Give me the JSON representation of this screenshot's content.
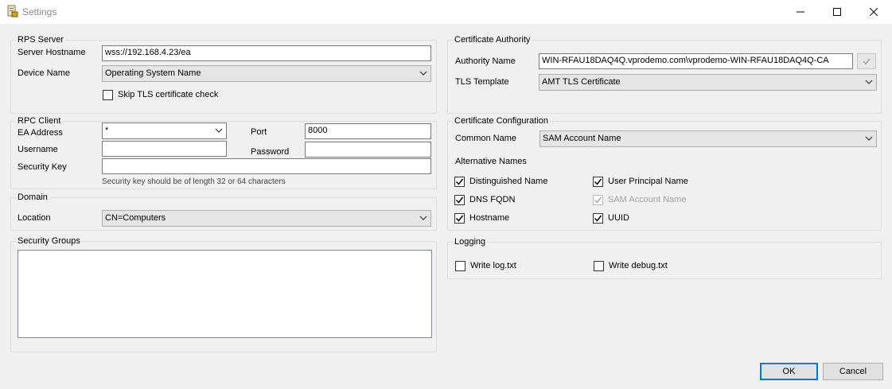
{
  "window": {
    "title": "Settings"
  },
  "rps_server": {
    "group_label": "RPS Server",
    "hostname_label": "Server Hostname",
    "hostname_value": "wss://192.168.4.23/ea",
    "device_name_label": "Device Name",
    "device_name_value": "Operating System Name",
    "skip_tls_label": "Skip TLS certificate check",
    "skip_tls_checked": false
  },
  "rpc_client": {
    "group_label": "RPC Client",
    "ea_address_label": "EA Address",
    "ea_address_value": "*",
    "port_label": "Port",
    "port_value": "8000",
    "username_label": "Username",
    "username_value": "",
    "password_label": "Password",
    "password_value": "",
    "security_key_label": "Security Key",
    "security_key_value": "",
    "security_key_hint": "Security key should be of length 32 or 64 characters"
  },
  "domain": {
    "group_label": "Domain",
    "location_label": "Location",
    "location_value": "CN=Computers"
  },
  "security_groups": {
    "group_label": "Security Groups"
  },
  "certificate_authority": {
    "group_label": "Certificate Authority",
    "authority_name_label": "Authority Name",
    "authority_name_value": "WIN-RFAU18DAQ4Q.vprodemo.com\\vprodemo-WIN-RFAU18DAQ4Q-CA",
    "tls_template_label": "TLS Template",
    "tls_template_value": "AMT TLS Certificate"
  },
  "certificate_configuration": {
    "group_label": "Certificate Configuration",
    "common_name_label": "Common Name",
    "common_name_value": "SAM Account Name",
    "alt_names_label": "Alternative Names",
    "alt_names": {
      "distinguished_name": "Distinguished Name",
      "user_principal_name": "User Principal Name",
      "dns_fqdn": "DNS FQDN",
      "sam_account_name": "SAM Account Name",
      "hostname": "Hostname",
      "uuid": "UUID"
    }
  },
  "logging": {
    "group_label": "Logging",
    "write_log_label": "Write log.txt",
    "write_debug_label": "Write debug.txt"
  },
  "buttons": {
    "ok": "OK",
    "cancel": "Cancel"
  },
  "colors": {
    "window_bg": "#f0f0f0",
    "accent": "#0078d7"
  }
}
